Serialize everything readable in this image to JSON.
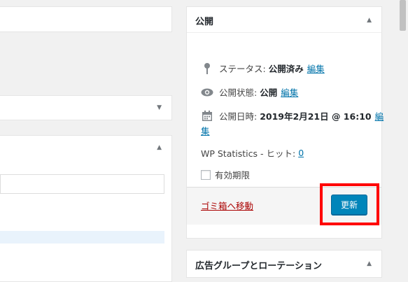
{
  "publish_box": {
    "title": "公開",
    "status_label": "ステータス:",
    "status_value": "公開済み",
    "status_edit": "編集",
    "visibility_label": "公開状態:",
    "visibility_value": "公開",
    "visibility_edit": "編集",
    "date_label": "公開日時:",
    "date_value": "2019年2月21日 @ 16:10",
    "date_edit_1": "編",
    "date_edit_2": "集",
    "stats_label": "WP Statistics - ヒット:",
    "stats_value": "0",
    "expiry_label": "有効期限",
    "trash_link": "ゴミ箱へ移動",
    "update_button": "更新"
  },
  "ad_box": {
    "title": "広告グループとローテーション"
  },
  "icons": [
    "pin-icon",
    "eye-icon",
    "calendar-icon",
    "collapse-arrow-icon",
    "expand-arrow-icon"
  ],
  "colors": {
    "accent": "#0073aa",
    "button": "#0085ba",
    "trash": "#a00",
    "highlight": "#ff0000"
  }
}
